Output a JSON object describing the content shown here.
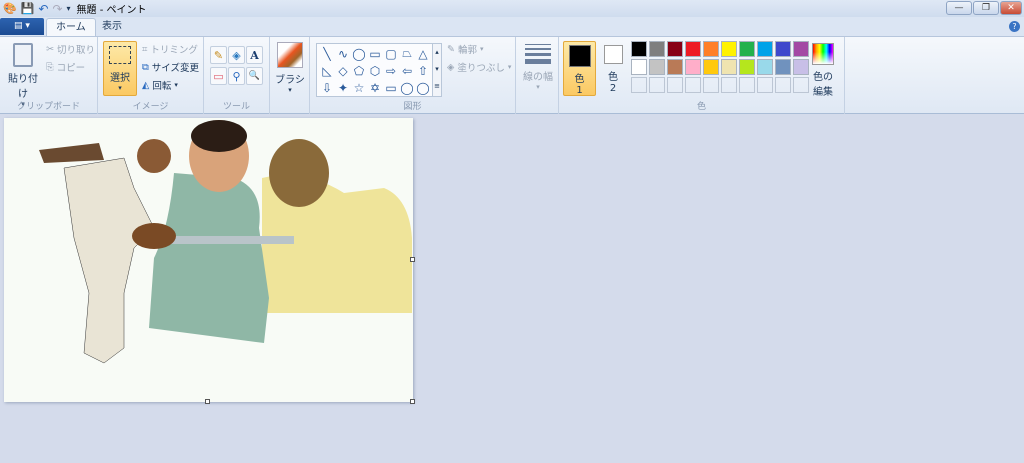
{
  "title": "無題 - ペイント",
  "tabs": {
    "file": "▤ ▾",
    "home": "ホーム",
    "view": "表示"
  },
  "window_controls": {
    "minimize": "—",
    "maximize": "❐",
    "close": "✕"
  },
  "clipboard": {
    "paste": "貼り付け",
    "cut": "切り取り",
    "copy": "コピー",
    "label": "クリップボード"
  },
  "image": {
    "select": "選択",
    "crop": "トリミング",
    "resize": "サイズ変更",
    "rotate": "回転",
    "label": "イメージ"
  },
  "tools": {
    "label": "ツール",
    "items": [
      "✎",
      "◈",
      "A",
      "▭",
      "⚲",
      "🔍"
    ]
  },
  "brush": {
    "label": "ブラシ"
  },
  "shapes": {
    "label": "図形",
    "outline": "輪郭",
    "fill": "塗りつぶし",
    "items": [
      "╲",
      "∿",
      "◯",
      "▭",
      "▢",
      "⏢",
      "△",
      "◺",
      "◇",
      "⬠",
      "⬡",
      "⇨",
      "⇦",
      "⇧",
      "⇩",
      "✦",
      "☆",
      "✡",
      "▭",
      "◯",
      "◯"
    ]
  },
  "size": {
    "label": "線の幅"
  },
  "colors": {
    "color1": "色\n1",
    "color1_a": "色",
    "color1_b": "1",
    "color2_a": "色",
    "color2_b": "2",
    "edit_a": "色の",
    "edit_b": "編集",
    "label": "色",
    "palette": [
      "#000000",
      "#7f7f7f",
      "#880015",
      "#ed1c24",
      "#ff7f27",
      "#fff200",
      "#22b14c",
      "#00a2e8",
      "#3f48cc",
      "#a349a4",
      "#ffffff",
      "#c3c3c3",
      "#b97a57",
      "#ffaec9",
      "#ffc90e",
      "#efe4b0",
      "#b5e61d",
      "#99d9ea",
      "#7092be",
      "#c8bfe7",
      "",
      "",
      "",
      "",
      "",
      "",
      "",
      "",
      "",
      ""
    ]
  }
}
